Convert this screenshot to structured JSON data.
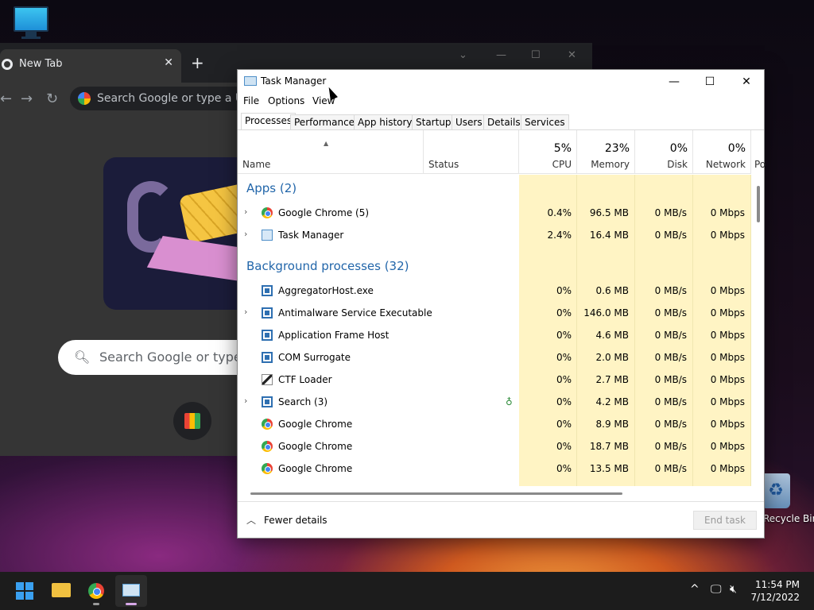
{
  "desktop": {
    "recycle_bin_label": "Recycle Bin"
  },
  "chrome": {
    "tab_title": "New Tab",
    "tab_close": "✕",
    "new_tab": "+",
    "omnibox_placeholder": "Search Google or type a URL",
    "search_placeholder": "Search Google or type a URL"
  },
  "task_manager": {
    "title": "Task Manager",
    "menu": [
      "File",
      "Options",
      "View"
    ],
    "tabs": [
      "Processes",
      "Performance",
      "App history",
      "Startup",
      "Users",
      "Details",
      "Services"
    ],
    "active_tab": "Processes",
    "columns": {
      "name": "Name",
      "status": "Status",
      "cpu": {
        "pct": "5%",
        "label": "CPU"
      },
      "memory": {
        "pct": "23%",
        "label": "Memory"
      },
      "disk": {
        "pct": "0%",
        "label": "Disk"
      },
      "network": {
        "pct": "0%",
        "label": "Network"
      },
      "power": "Po"
    },
    "groups": {
      "apps": "Apps (2)",
      "background": "Background processes (32)"
    },
    "apps": [
      {
        "name": "Google Chrome (5)",
        "icon": "chrome-icon",
        "expand": true,
        "cpu": "0.4%",
        "memory": "96.5 MB",
        "disk": "0 MB/s",
        "network": "0 Mbps"
      },
      {
        "name": "Task Manager",
        "icon": "task-manager-icon",
        "expand": true,
        "cpu": "2.4%",
        "memory": "16.4 MB",
        "disk": "0 MB/s",
        "network": "0 Mbps"
      }
    ],
    "background": [
      {
        "name": "AggregatorHost.exe",
        "icon": "window-icon",
        "expand": false,
        "cpu": "0%",
        "memory": "0.6 MB",
        "disk": "0 MB/s",
        "network": "0 Mbps"
      },
      {
        "name": "Antimalware Service Executable",
        "icon": "window-icon",
        "expand": true,
        "cpu": "0%",
        "memory": "146.0 MB",
        "disk": "0 MB/s",
        "network": "0 Mbps"
      },
      {
        "name": "Application Frame Host",
        "icon": "window-icon",
        "expand": false,
        "cpu": "0%",
        "memory": "4.6 MB",
        "disk": "0 MB/s",
        "network": "0 Mbps"
      },
      {
        "name": "COM Surrogate",
        "icon": "window-icon",
        "expand": false,
        "cpu": "0%",
        "memory": "2.0 MB",
        "disk": "0 MB/s",
        "network": "0 Mbps"
      },
      {
        "name": "CTF Loader",
        "icon": "pen-icon",
        "expand": false,
        "cpu": "0%",
        "memory": "2.7 MB",
        "disk": "0 MB/s",
        "network": "0 Mbps"
      },
      {
        "name": "Search (3)",
        "icon": "window-icon",
        "expand": true,
        "status_icon": "leaf-icon",
        "cpu": "0%",
        "memory": "4.2 MB",
        "disk": "0 MB/s",
        "network": "0 Mbps"
      },
      {
        "name": "Google Chrome",
        "icon": "chrome-icon",
        "expand": false,
        "cpu": "0%",
        "memory": "8.9 MB",
        "disk": "0 MB/s",
        "network": "0 Mbps"
      },
      {
        "name": "Google Chrome",
        "icon": "chrome-icon",
        "expand": false,
        "cpu": "0%",
        "memory": "18.7 MB",
        "disk": "0 MB/s",
        "network": "0 Mbps"
      },
      {
        "name": "Google Chrome",
        "icon": "chrome-icon",
        "expand": false,
        "cpu": "0%",
        "memory": "13.5 MB",
        "disk": "0 MB/s",
        "network": "0 Mbps"
      }
    ],
    "fewer_details": "Fewer details",
    "end_task": "End task"
  },
  "taskbar": {
    "time": "11:54 PM",
    "date": "7/12/2022"
  },
  "colors": {
    "heat": "#fff4c4",
    "group_text": "#2266aa",
    "taskbar": "#1c1c1c"
  }
}
